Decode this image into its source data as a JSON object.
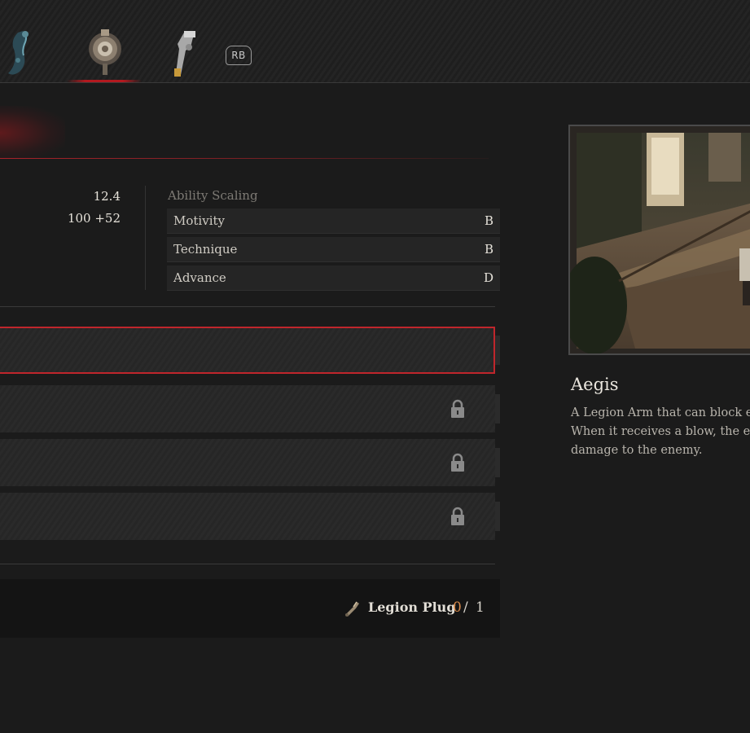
{
  "tabs": {
    "items": [
      {
        "icon": "legion-arm-flamberge-icon",
        "active": false
      },
      {
        "icon": "legion-arm-aegis-icon",
        "active": true
      },
      {
        "icon": "legion-arm-pulse-cannon-icon",
        "active": false
      }
    ],
    "next_button": "RB"
  },
  "stats": {
    "values": [
      "12.4",
      "100 +52"
    ]
  },
  "ability_scaling": {
    "title": "Ability Scaling",
    "rows": [
      {
        "label": "Motivity",
        "grade": "B"
      },
      {
        "label": "Technique",
        "grade": "B"
      },
      {
        "label": "Advance",
        "grade": "D"
      }
    ]
  },
  "upgrade_slots": [
    {
      "locked": false,
      "selected": true
    },
    {
      "locked": true,
      "selected": false
    },
    {
      "locked": true,
      "selected": false
    },
    {
      "locked": true,
      "selected": false
    }
  ],
  "cost": {
    "item_name": "Legion Plug",
    "have": "0",
    "separator": "/",
    "need": "1"
  },
  "item": {
    "name": "Aegis",
    "description_lines": [
      "A Legion Arm that can block ene",
      "When it receives a blow, the embo",
      "damage to the enemy."
    ]
  },
  "colors": {
    "accent_red": "#c0262c",
    "cost_have": "#d98a4a"
  }
}
